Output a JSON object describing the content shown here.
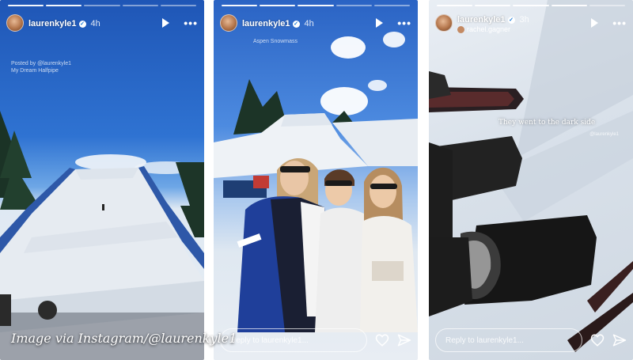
{
  "stories": [
    {
      "username": "laurenkyle1",
      "time": "4h",
      "reply_placeholder": "",
      "caption_note": "Posted by @laurenkyle1\nMy Dream Halfpipe"
    },
    {
      "username": "laurenkyle1",
      "time": "4h",
      "reply_placeholder": "Reply to laurenkyle1...",
      "caption_note": "Aspen Snowmass"
    },
    {
      "username": "laurenkyle1",
      "time": "3h",
      "tagged_user": "rachel.gagner",
      "reply_placeholder": "Reply to laurenkyle1...",
      "overlay_text": "They went to the dark side",
      "overlay_tag": "@laurenkyle1"
    }
  ],
  "icons": {
    "verified": "✓",
    "more": "•••"
  },
  "watermark": "Image via Instagram/@laurenkyle1"
}
